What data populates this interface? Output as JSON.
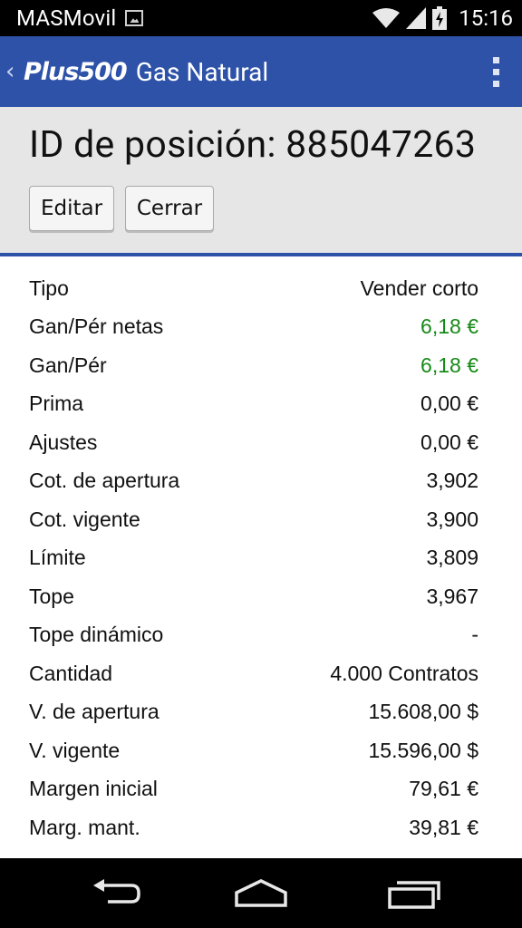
{
  "status_bar": {
    "carrier": "MASMovil",
    "time": "15:16",
    "icons": [
      "gallery-icon",
      "wifi-icon",
      "signal-icon",
      "battery-charging-icon"
    ]
  },
  "action_bar": {
    "back_icon": "chevron-left-icon",
    "logo": "Plus500",
    "title": "Gas Natural",
    "menu_icon": "overflow-menu-icon"
  },
  "header": {
    "title": "ID de posición: 885047263",
    "buttons": {
      "edit": "Editar",
      "close": "Cerrar"
    }
  },
  "colors": {
    "accent": "#2d52a8",
    "positive": "#168a16",
    "panel": "#e6e6e6"
  },
  "details": [
    {
      "label": "Tipo",
      "value": "Vender corto"
    },
    {
      "label": "Gan/Pér netas",
      "value": "6,18 €",
      "highlight": true
    },
    {
      "label": "Gan/Pér",
      "value": "6,18 €",
      "highlight": true
    },
    {
      "label": "Prima",
      "value": "0,00 €"
    },
    {
      "label": "Ajustes",
      "value": "0,00 €"
    },
    {
      "label": "Cot. de apertura",
      "value": "3,902"
    },
    {
      "label": "Cot. vigente",
      "value": "3,900"
    },
    {
      "label": "Límite",
      "value": "3,809"
    },
    {
      "label": "Tope",
      "value": "3,967"
    },
    {
      "label": "Tope dinámico",
      "value": "-"
    },
    {
      "label": "Cantidad",
      "value": "4.000 Contratos"
    },
    {
      "label": "V. de apertura",
      "value": "15.608,00 $"
    },
    {
      "label": "V. vigente",
      "value": "15.596,00 $"
    },
    {
      "label": "Margen inicial",
      "value": "79,61 €"
    },
    {
      "label": "Marg. mant.",
      "value": "39,81 €"
    }
  ],
  "nav_bar": {
    "icons": [
      "back-icon",
      "home-icon",
      "recent-apps-icon"
    ]
  }
}
